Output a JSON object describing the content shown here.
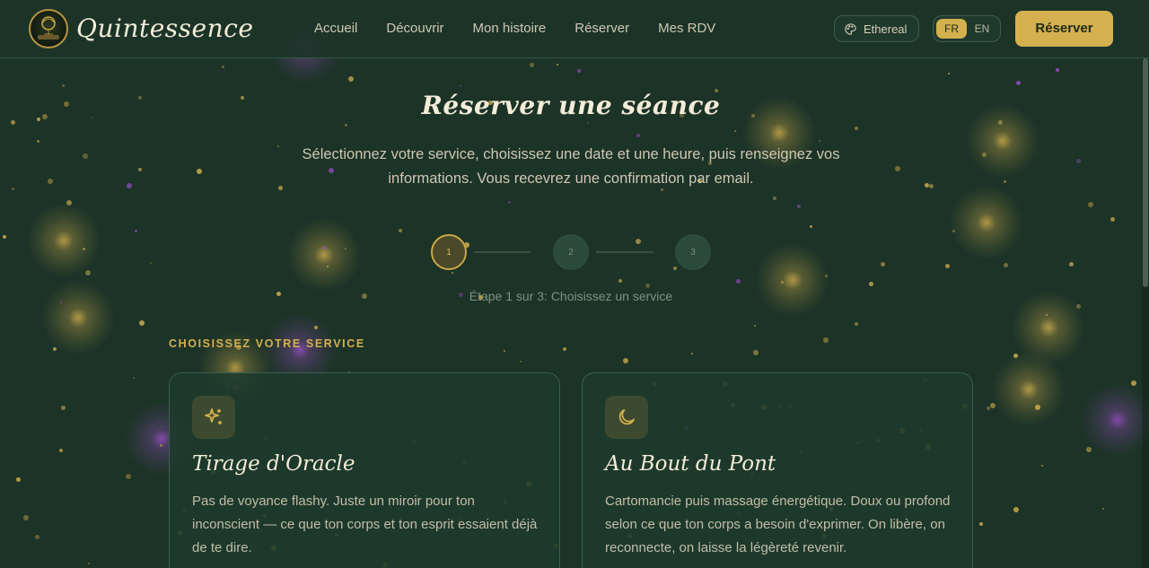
{
  "brand": {
    "name": "Quintessence"
  },
  "nav": {
    "items": [
      {
        "label": "Accueil"
      },
      {
        "label": "Découvrir"
      },
      {
        "label": "Mon histoire"
      },
      {
        "label": "Réserver"
      },
      {
        "label": "Mes RDV"
      }
    ]
  },
  "theme": {
    "label": "Ethereal",
    "icon": "palette-icon"
  },
  "language": {
    "options": [
      "FR",
      "EN"
    ],
    "selected": "FR"
  },
  "header_cta": {
    "label": "Réserver"
  },
  "page": {
    "title": "Réserver une séance",
    "subtitle": "Sélectionnez votre service, choisissez une date et une heure, puis renseignez vos informations. Vous recevrez une confirmation par email."
  },
  "stepper": {
    "steps": [
      "1",
      "2",
      "3"
    ],
    "current": 1,
    "caption": "Étape 1 sur 3: Choisissez un service"
  },
  "services": {
    "section_label": "CHOISISSEZ VOTRE SERVICE",
    "items": [
      {
        "icon": "sparkles-icon",
        "title": "Tirage d'Oracle",
        "description": "Pas de voyance flashy. Juste un miroir pour ton inconscient — ce que ton corps et ton esprit essaient déjà de te dire."
      },
      {
        "icon": "moon-icon",
        "title": "Au Bout du Pont",
        "description": "Cartomancie puis massage énergétique. Doux ou profond selon ce que ton corps a besoin d'exprimer. On libère, on reconnecte, on laisse la légèreté revenir."
      }
    ]
  },
  "colors": {
    "background": "#1c3327",
    "accent_gold": "#d4b04e",
    "accent_purple": "#9b4fc7",
    "text_light": "#f3ecd8"
  }
}
